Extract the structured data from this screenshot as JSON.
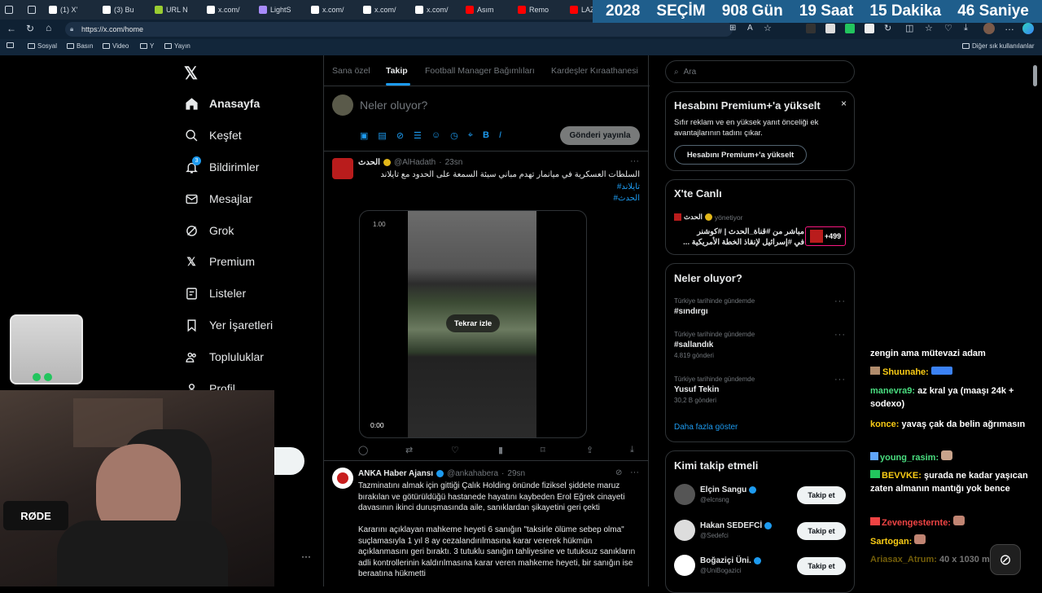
{
  "browser": {
    "tabs": [
      "(1) X'",
      "(3) Bu",
      "URL N",
      "x.com/",
      "LightS",
      "x.com/",
      "x.com/",
      "x.com/",
      "Asım",
      "Remo",
      "LAZ"
    ],
    "url": "https://x.com/home",
    "bookmarks": [
      "Sosyal",
      "Basın",
      "Video",
      "Y",
      "Yayın"
    ],
    "other_bookmarks": "Diğer sık kullanılanlar"
  },
  "countdown": {
    "year": "2028",
    "label": "SEÇİM",
    "days": "908 Gün",
    "hours": "19 Saat",
    "minutes": "15 Dakika",
    "seconds": "46 Saniye"
  },
  "nav": {
    "items": [
      "Anasayfa",
      "Keşfet",
      "Bildirimler",
      "Mesajlar",
      "Grok",
      "Premium",
      "Listeler",
      "Yer İşaretleri",
      "Topluluklar",
      "Profil"
    ],
    "notif_badge": "3"
  },
  "feed": {
    "tabs": [
      "Sana özel",
      "Takip",
      "Football Manager Bağımlıları",
      "Kardeşler Kıraathanesi"
    ],
    "compose_placeholder": "Neler oluyor?",
    "post_button": "Gönderi yayınla",
    "tweet1": {
      "name": "الحدث",
      "handle": "@AlHadath",
      "time": "23sn",
      "text": "السلطات العسكرية في ميانمار تهدم مباني سيئة السمعة على الحدود مع تايلاند",
      "hashtag1": "#تايلاند",
      "hashtag2": "#الحدث",
      "video_speed": "1.00",
      "video_time": "0:00",
      "replay": "Tekrar izle"
    },
    "tweet2": {
      "name": "ANKA Haber Ajansı",
      "handle": "@ankahabera",
      "time": "29sn",
      "p1": "Tazminatını almak için gittiği Çalık Holding önünde fiziksel şiddete maruz bırakılan ve götürüldüğü hastanede hayatını kaybeden Erol Eğrek cinayeti davasının ikinci duruşmasında aile, sanıklardan şikayetini geri çekti",
      "p2": "Kararını açıklayan mahkeme heyeti 6 sanığın \"taksirle ölüme sebep olma\" suçlamasıyla 1 yıl 8 ay cezalandırılmasına karar vererek hükmün açıklanmasını geri bıraktı. 3 tutuklu sanığın tahliyesine ve tutuksuz sanıkların adli kontrollerinin kaldırılmasına karar veren mahkeme heyeti, bir sanığın ise beraatına hükmetti"
    }
  },
  "sidebar": {
    "search_placeholder": "Ara",
    "premium": {
      "title": "Hesabını Premium+'a yükselt",
      "desc": "Sıfır reklam ve en yüksek yanıt önceliği ek avantajlarının tadını çıkar.",
      "button": "Hesabını Premium+'a yükselt"
    },
    "live": {
      "title": "X'te Canlı",
      "host": "الحدث",
      "host_status": "yönetiyor",
      "text1": "مباشر من #قناة_الحدث | #كوشنر",
      "text2": "في #إسرائيل لإنقاذ الخطة الأمريكية ...",
      "count": "+499"
    },
    "trends": {
      "title": "Neler oluyor?",
      "items": [
        {
          "context": "Türkiye tarihinde gündemde",
          "name": "#sındırgı",
          "posts": ""
        },
        {
          "context": "Türkiye tarihinde gündemde",
          "name": "#sallandık",
          "posts": "4.819 gönderi"
        },
        {
          "context": "Türkiye tarihinde gündemde",
          "name": "Yusuf Tekin",
          "posts": "30,2 B gönderi"
        }
      ],
      "more": "Daha fazla göster"
    },
    "who": {
      "title": "Kimi takip etmeli",
      "follow_label": "Takip et",
      "users": [
        {
          "name": "Elçin Sangu",
          "handle": "@elcnsng"
        },
        {
          "name": "Hakan SEDEFCİ",
          "handle": "@Sedefci"
        },
        {
          "name": "Boğaziçi Üni.",
          "handle": "@UniBogazici"
        }
      ]
    }
  },
  "chat": [
    {
      "name": "",
      "msg": "zengin ama mütevazi adam"
    },
    {
      "name": "Shuunahe:",
      "msg": ""
    },
    {
      "name": "manevra9:",
      "msg": "az kral ya (maaşı 24k + sodexo)"
    },
    {
      "name": "konce:",
      "msg": "yavaş çak da belin ağrımasın"
    },
    {
      "name": "young_rasim:",
      "msg": ""
    },
    {
      "name": "BEVVKE:",
      "msg": "şurada ne kadar yaşıcan zaten almanın mantığı yok bence"
    },
    {
      "name": "Zevengesternte:",
      "msg": ""
    },
    {
      "name": "Sartogan:",
      "msg": ""
    },
    {
      "name": "Ariasax_Atrum:",
      "msg": "40 x 1030 milyon"
    }
  ],
  "colors": {
    "accent": "#1d9bf0",
    "countdown_bg": "#1f5e8c",
    "chat_green": "#4ade80",
    "chat_red": "#ef4444",
    "chat_yellow": "#facc15"
  }
}
